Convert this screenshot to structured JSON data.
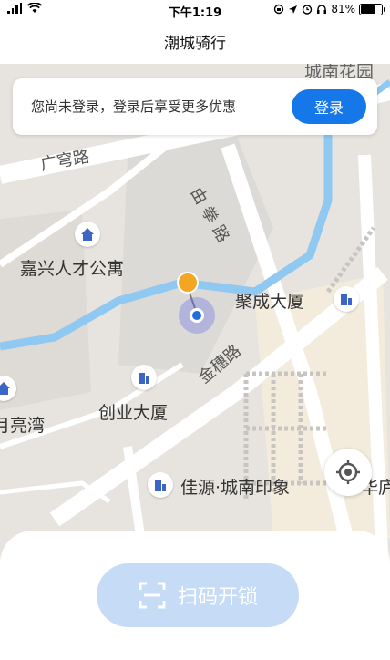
{
  "status_bar": {
    "time": "下午1:19",
    "battery": "81%",
    "battery_level": 0.81
  },
  "title": "潮城骑行",
  "login_banner": {
    "text": "您尚未登录，登录后享受更多优惠",
    "button": "登录"
  },
  "map": {
    "places": [
      "嘉兴人才公寓",
      "聚成大厦",
      "创业大厦",
      "月亮湾",
      "佳源·城南印象",
      "华庐",
      "城南花园"
    ],
    "roads": [
      "广穹路",
      "由拳路",
      "金穗路"
    ]
  },
  "bottom": {
    "scan_button": "扫码开锁"
  },
  "colors": {
    "accent": "#1677e8",
    "scan_button_bg": "#c5dbf6",
    "pin": "#f2a623",
    "user_dot": "#1e6fe0"
  }
}
